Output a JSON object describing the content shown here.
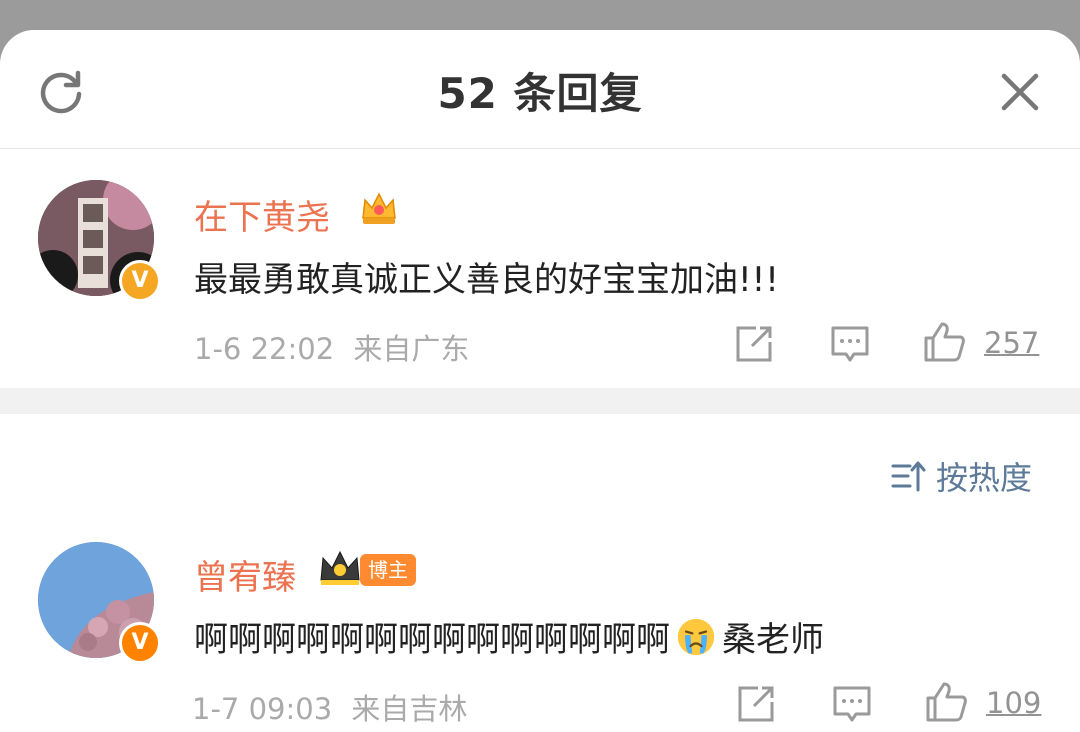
{
  "header": {
    "title": "52 条回复"
  },
  "comments": [
    {
      "username": "在下黄尧",
      "text": "最最勇敢真诚正义善良的好宝宝加油!!!",
      "time": "1-6 22:02",
      "location": "来自广东",
      "likes": "257"
    },
    {
      "username": "曾宥臻",
      "badge": "博主",
      "text_prefix": "啊啊啊啊啊啊啊啊啊啊啊啊啊啊",
      "text_suffix": "桑老师",
      "time": "1-7 09:03",
      "location": "来自吉林",
      "likes": "109"
    }
  ],
  "sort": {
    "label": "按热度"
  },
  "colors": {
    "username": "#eb7350",
    "link": "#5d7a99",
    "meta": "#aaaaaa"
  }
}
